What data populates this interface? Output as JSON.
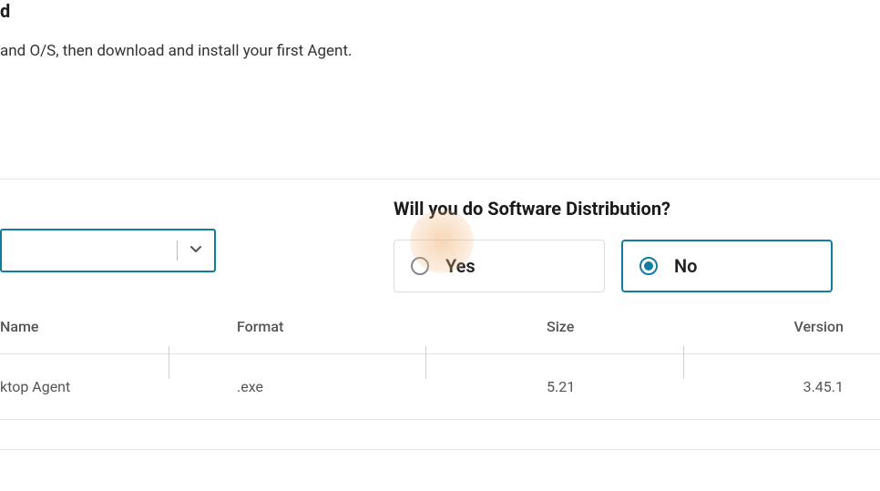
{
  "header": {
    "title_fragment": "d",
    "subtitle": "and O/S, then download and install your first Agent."
  },
  "question": {
    "label": "Will you do Software Distribution?",
    "options": {
      "yes": "Yes",
      "no": "No"
    }
  },
  "table": {
    "headers": {
      "name": "Name",
      "format": "Format",
      "size": "Size",
      "version": "Version"
    },
    "rows": [
      {
        "name": "ktop Agent",
        "format": ".exe",
        "size": "5.21",
        "version": "3.45.1"
      }
    ]
  }
}
